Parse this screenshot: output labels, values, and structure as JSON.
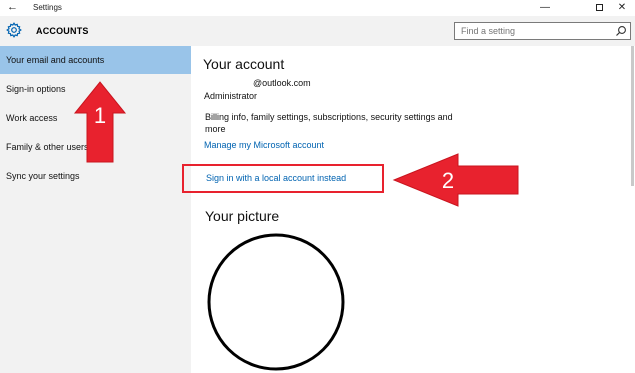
{
  "titlebar": {
    "back_icon": "back-arrow-icon",
    "title": "Settings",
    "controls": [
      "minimize-icon",
      "maximize-icon",
      "close-icon"
    ]
  },
  "header": {
    "icon": "gear-icon",
    "title": "ACCOUNTS",
    "search_placeholder": "Find a setting",
    "search_icon": "search-icon"
  },
  "sidebar": {
    "items": [
      {
        "label": "Your email and accounts",
        "active": true
      },
      {
        "label": "Sign-in options",
        "active": false
      },
      {
        "label": "Work access",
        "active": false
      },
      {
        "label": "Family & other users",
        "active": false
      },
      {
        "label": "Sync your settings",
        "active": false
      }
    ]
  },
  "main": {
    "account_heading": "Your account",
    "email": "@outlook.com",
    "role": "Administrator",
    "billing_text": "Billing info, family settings, subscriptions, security settings and more",
    "manage_link": "Manage my Microsoft account",
    "local_link": "Sign in with a local account instead",
    "picture_heading": "Your picture"
  },
  "annotations": {
    "arrow1_label": "1",
    "arrow2_label": "2",
    "color": "#e8222e"
  },
  "colors": {
    "accent": "#0063b1",
    "selection": "#99c4e9",
    "sidebar_bg": "#f2f2f2"
  }
}
